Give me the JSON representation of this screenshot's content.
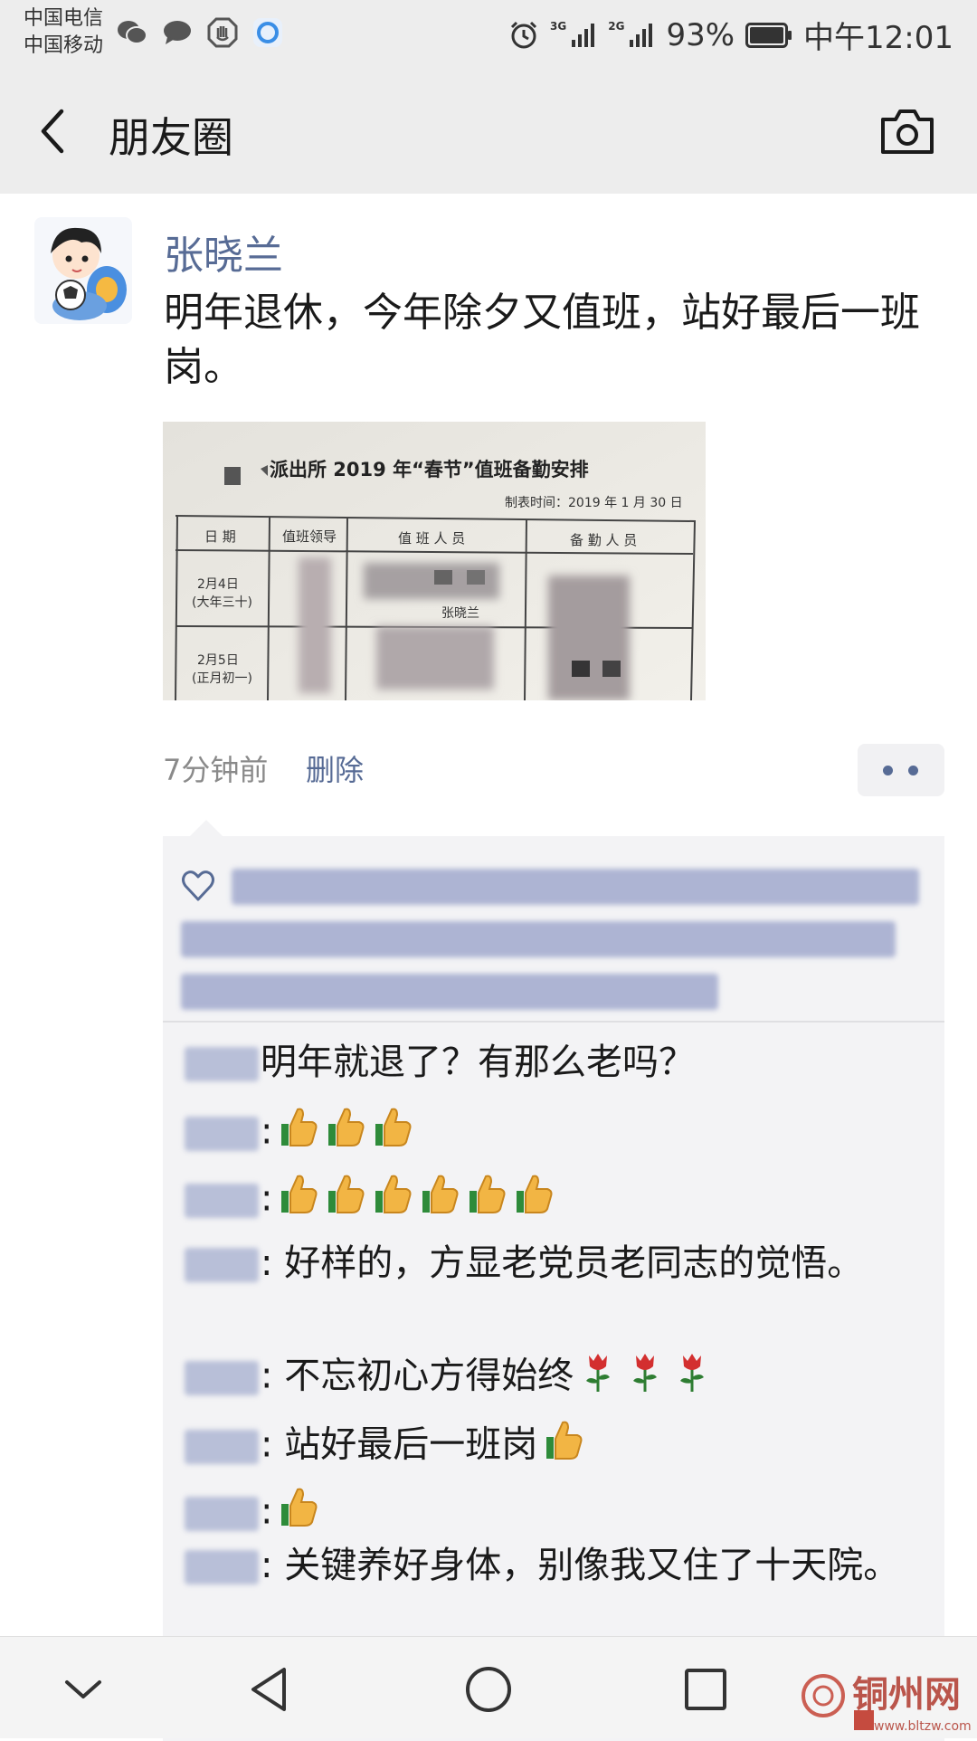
{
  "status_bar": {
    "carrier_1": "中国电信",
    "carrier_2": "中国移动",
    "network_1": "3G",
    "network_2": "2G",
    "battery": "93%",
    "time": "中午12:01"
  },
  "nav": {
    "title": "朋友圈"
  },
  "post": {
    "author": "张晓兰",
    "text": "明年退休，今年除夕又值班，站好最后一班岗。",
    "photo": {
      "heading": "派出所 2019 年“春节”值班备勤安排",
      "date_line": "制表时间：2019 年 1 月 30 日",
      "columns": [
        "日 期",
        "值班领导",
        "值 班 人 员",
        "备 勤 人 员"
      ],
      "rows": [
        {
          "date": "2月4日",
          "sub": "(大年三十)",
          "staff": "张晓兰"
        },
        {
          "date": "2月5日",
          "sub": "(正月初一)",
          "staff": ""
        }
      ]
    },
    "time_ago": "7分钟前",
    "delete_label": "删除"
  },
  "comments": [
    {
      "text": "明年就退了？有那么老吗？",
      "emoji": []
    },
    {
      "text": ":",
      "emoji": [
        "thumbs-up",
        "thumbs-up",
        "thumbs-up"
      ]
    },
    {
      "text": ":",
      "emoji": [
        "thumbs-up",
        "thumbs-up",
        "thumbs-up",
        "thumbs-up",
        "thumbs-up",
        "thumbs-up"
      ]
    },
    {
      "text": ": 好样的，方显老党员老同志的觉悟。",
      "emoji": []
    },
    {
      "text": ": 不忘初心方得始终",
      "emoji": [
        "rose",
        "rose",
        "rose"
      ]
    },
    {
      "text": ": 站好最后一班岗",
      "emoji": [
        "thumbs-up"
      ]
    },
    {
      "text": ":",
      "emoji": [
        "thumbs-up"
      ]
    },
    {
      "text": ": 关键养好身体，别像我又住了十天院。",
      "emoji": []
    }
  ],
  "watermark": {
    "brand": "铜州网",
    "url": "www.bltzw.com"
  },
  "colors": {
    "link_blue": "#576b95",
    "bar_gray": "#ededed",
    "comment_bg": "#f3f3f5"
  }
}
